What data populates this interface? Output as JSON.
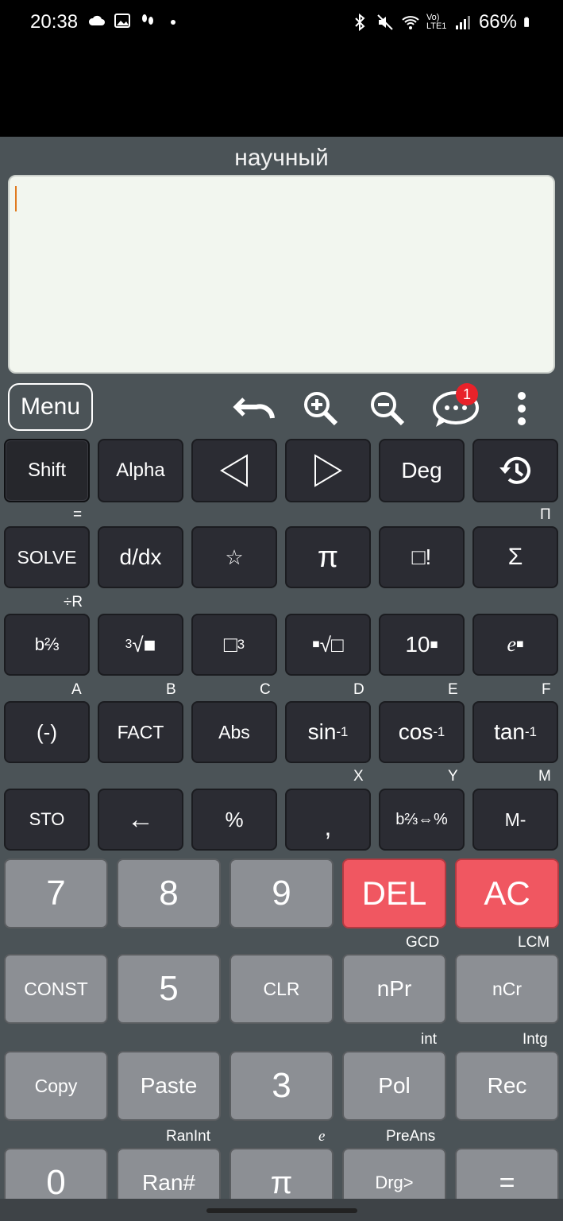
{
  "status": {
    "time": "20:38",
    "battery": "66%",
    "network": "Vo) LTE1"
  },
  "mode_title": "научный",
  "toolbar": {
    "menu_label": "Menu",
    "chat_badge": "1"
  },
  "keys": {
    "row1": [
      "Shift",
      "Alpha",
      "◁",
      "▷",
      "Deg",
      "history"
    ],
    "row2": [
      "SOLVE",
      "d/dx",
      "☆",
      "π",
      "□!",
      "Σ"
    ],
    "row2_sub": {
      "solve": "=",
      "sum": "Π"
    },
    "row3_sub": {
      "b": "÷R"
    },
    "row4_sub": [
      "A",
      "B",
      "C",
      "D",
      "E",
      "F"
    ],
    "row4": [
      "(-)",
      "FACT",
      "Abs",
      "sin",
      "cos",
      "tan"
    ],
    "inverse_exp": "-1",
    "row5_sub": {
      "comma": "X",
      "frac": "Y",
      "m": "M"
    },
    "row5": [
      "STO",
      "←",
      "%",
      ",",
      "b⅔⇔%",
      "M-"
    ],
    "row6": [
      "7",
      "8",
      "9",
      "DEL",
      "AC"
    ],
    "row7_sub": {
      "npr": "GCD",
      "ncr": "LCM"
    },
    "row7": [
      "CONST",
      "5",
      "CLR",
      "nPr",
      "nCr"
    ],
    "row8_sub": {
      "pol": "int",
      "rec": "Intg"
    },
    "row8": [
      "Copy",
      "Paste",
      "3",
      "Pol",
      "Rec"
    ],
    "row9_sub": {
      "ran": "RanInt",
      "pi": "e",
      "drg": "PreAns"
    },
    "row9": [
      "0",
      "Ran#",
      "π",
      "Drg>",
      "="
    ]
  },
  "row3_labels": {
    "frac": "b⅔",
    "cube_root_idx": "3",
    "cube_exp": "3",
    "ten": "10"
  }
}
